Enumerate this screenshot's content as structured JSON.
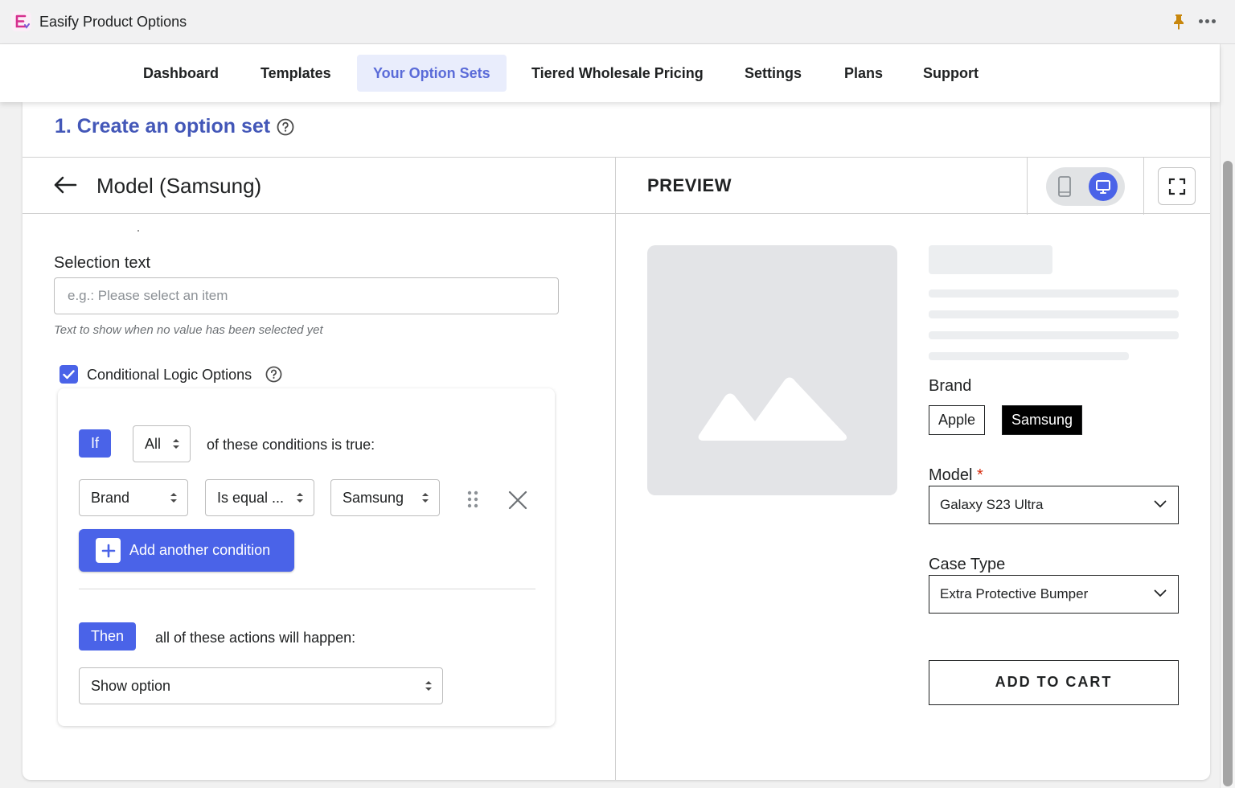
{
  "app": {
    "title": "Easify Product Options"
  },
  "nav": {
    "items": [
      {
        "label": "Dashboard"
      },
      {
        "label": "Templates"
      },
      {
        "label": "Your Option Sets",
        "active": true
      },
      {
        "label": "Tiered Wholesale Pricing"
      },
      {
        "label": "Settings"
      },
      {
        "label": "Plans"
      },
      {
        "label": "Support"
      }
    ]
  },
  "section": {
    "title": "1. Create an option set"
  },
  "option": {
    "title": "Model (Samsung)"
  },
  "selection_text": {
    "label": "Selection text",
    "placeholder": "e.g.: Please select an item",
    "value": "",
    "help": "Text to show when no value has been selected yet"
  },
  "conditional": {
    "checked": true,
    "label": "Conditional Logic Options",
    "if_label": "If",
    "match_mode": "All",
    "match_text": "of these conditions is true:",
    "condition": {
      "field": "Brand",
      "operator": "Is equal ...",
      "value": "Samsung"
    },
    "add_condition_label": "Add another condition",
    "then_label": "Then",
    "then_text": "all of these actions will happen:",
    "action": "Show option"
  },
  "preview": {
    "label": "PREVIEW",
    "device": "desktop",
    "brand_label": "Brand",
    "brands": [
      "Apple",
      "Samsung"
    ],
    "selected_brand": "Samsung",
    "model_label": "Model",
    "model_required_mark": "*",
    "model_value": "Galaxy S23 Ultra",
    "case_label": "Case Type",
    "case_value": "Extra Protective Bumper",
    "add_to_cart": "ADD TO CART"
  },
  "colors": {
    "accent": "#4a63e8",
    "title_blue": "#4357b8",
    "active_nav_bg": "#e9edfc",
    "active_nav_text": "#5a6bd8",
    "required": "#d72c0d"
  },
  "icons": [
    "app-logo-icon",
    "pin-icon",
    "more-icon",
    "help-icon",
    "back-arrow-icon",
    "mobile-icon",
    "desktop-icon",
    "fullscreen-icon",
    "checkbox-check-icon",
    "select-arrows-icon",
    "drag-handle-icon",
    "close-icon",
    "plus-icon",
    "image-placeholder-icon",
    "chevron-down-icon"
  ]
}
